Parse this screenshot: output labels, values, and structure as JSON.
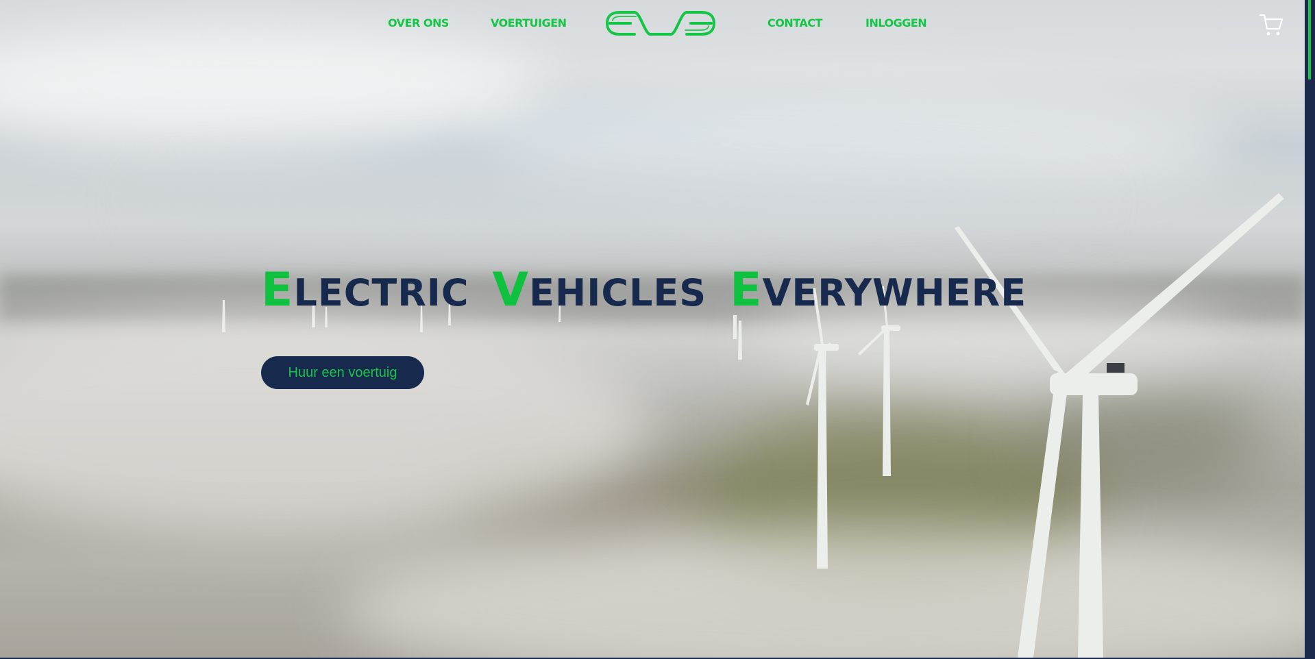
{
  "nav": {
    "links": [
      "OVER ONS",
      "VOERTUIGEN",
      "CONTACT",
      "INLOGGEN"
    ],
    "logo_text": "EVE",
    "cart_icon": "cart-icon"
  },
  "hero": {
    "headline": [
      {
        "first": "E",
        "rest": "LECTRIC"
      },
      {
        "first": "V",
        "rest": "EHICLES"
      },
      {
        "first": "E",
        "rest": "VERYWHERE"
      }
    ],
    "cta_label": "Huur een voertuig",
    "background": "aerial-wind-turbines-above-fog"
  },
  "colors": {
    "accent_green": "#14c646",
    "navy": "#172a4e"
  }
}
